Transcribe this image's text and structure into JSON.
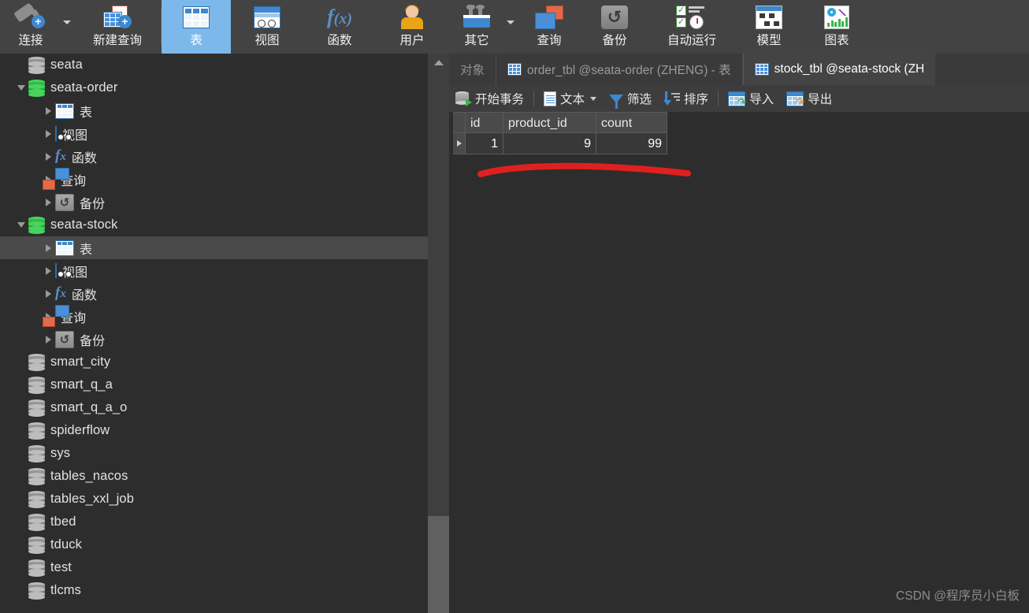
{
  "ribbon": {
    "items": [
      {
        "label": "连接",
        "icon": "plug-plus-icon",
        "has_caret": true,
        "active": false
      },
      {
        "label": "新建查询",
        "icon": "new-query-icon",
        "has_caret": false,
        "active": false
      },
      {
        "label": "表",
        "icon": "table-icon",
        "has_caret": false,
        "active": true
      },
      {
        "label": "视图",
        "icon": "view-icon",
        "has_caret": false,
        "active": false
      },
      {
        "label": "函数",
        "icon": "function-fx-icon",
        "has_caret": false,
        "active": false
      },
      {
        "label": "用户",
        "icon": "user-icon",
        "has_caret": false,
        "active": false
      },
      {
        "label": "其它",
        "icon": "toolbox-icon",
        "has_caret": true,
        "active": false
      },
      {
        "label": "查询",
        "icon": "query-icon",
        "has_caret": false,
        "active": false
      },
      {
        "label": "备份",
        "icon": "backup-icon",
        "has_caret": false,
        "active": false
      },
      {
        "label": "自动运行",
        "icon": "automation-icon",
        "has_caret": false,
        "active": false
      },
      {
        "label": "模型",
        "icon": "model-icon",
        "has_caret": false,
        "active": false
      },
      {
        "label": "图表",
        "icon": "chart-icon",
        "has_caret": false,
        "active": false
      }
    ],
    "active_bg": "#7cb8ea"
  },
  "sidebar": {
    "tree": [
      {
        "label": "seata",
        "type": "database",
        "icon": "database-gray-icon",
        "indent": 0,
        "twisty": "none",
        "selected": false
      },
      {
        "label": "seata-order",
        "type": "database",
        "icon": "database-green-icon",
        "indent": 0,
        "twisty": "expanded",
        "selected": false
      },
      {
        "label": "表",
        "type": "folder",
        "icon": "table-icon",
        "indent": 1,
        "twisty": "collapsed",
        "selected": false
      },
      {
        "label": "视图",
        "type": "folder",
        "icon": "view-icon",
        "indent": 1,
        "twisty": "collapsed",
        "selected": false
      },
      {
        "label": "函数",
        "type": "folder",
        "icon": "function-fx-icon",
        "indent": 1,
        "twisty": "collapsed",
        "selected": false
      },
      {
        "label": "查询",
        "type": "folder",
        "icon": "query-icon",
        "indent": 1,
        "twisty": "collapsed",
        "selected": false
      },
      {
        "label": "备份",
        "type": "folder",
        "icon": "backup-icon",
        "indent": 1,
        "twisty": "collapsed",
        "selected": false
      },
      {
        "label": "seata-stock",
        "type": "database",
        "icon": "database-green-icon",
        "indent": 0,
        "twisty": "expanded",
        "selected": false
      },
      {
        "label": "表",
        "type": "folder",
        "icon": "table-icon",
        "indent": 1,
        "twisty": "collapsed",
        "selected": true
      },
      {
        "label": "视图",
        "type": "folder",
        "icon": "view-icon",
        "indent": 1,
        "twisty": "collapsed",
        "selected": false
      },
      {
        "label": "函数",
        "type": "folder",
        "icon": "function-fx-icon",
        "indent": 1,
        "twisty": "collapsed",
        "selected": false
      },
      {
        "label": "查询",
        "type": "folder",
        "icon": "query-icon",
        "indent": 1,
        "twisty": "collapsed",
        "selected": false
      },
      {
        "label": "备份",
        "type": "folder",
        "icon": "backup-icon",
        "indent": 1,
        "twisty": "collapsed",
        "selected": false
      },
      {
        "label": "smart_city",
        "type": "database",
        "icon": "database-gray-icon",
        "indent": 0,
        "twisty": "none",
        "selected": false
      },
      {
        "label": "smart_q_a",
        "type": "database",
        "icon": "database-gray-icon",
        "indent": 0,
        "twisty": "none",
        "selected": false
      },
      {
        "label": "smart_q_a_o",
        "type": "database",
        "icon": "database-gray-icon",
        "indent": 0,
        "twisty": "none",
        "selected": false
      },
      {
        "label": "spiderflow",
        "type": "database",
        "icon": "database-gray-icon",
        "indent": 0,
        "twisty": "none",
        "selected": false
      },
      {
        "label": "sys",
        "type": "database",
        "icon": "database-gray-icon",
        "indent": 0,
        "twisty": "none",
        "selected": false
      },
      {
        "label": "tables_nacos",
        "type": "database",
        "icon": "database-gray-icon",
        "indent": 0,
        "twisty": "none",
        "selected": false
      },
      {
        "label": "tables_xxl_job",
        "type": "database",
        "icon": "database-gray-icon",
        "indent": 0,
        "twisty": "none",
        "selected": false
      },
      {
        "label": "tbed",
        "type": "database",
        "icon": "database-gray-icon",
        "indent": 0,
        "twisty": "none",
        "selected": false
      },
      {
        "label": "tduck",
        "type": "database",
        "icon": "database-gray-icon",
        "indent": 0,
        "twisty": "none",
        "selected": false
      },
      {
        "label": "test",
        "type": "database",
        "icon": "database-gray-icon",
        "indent": 0,
        "twisty": "none",
        "selected": false
      },
      {
        "label": "tlcms",
        "type": "database",
        "icon": "database-gray-icon",
        "indent": 0,
        "twisty": "none",
        "selected": false
      }
    ],
    "scrollbar": {
      "up_arrow_icon": "chevron-up-icon"
    }
  },
  "tabs": [
    {
      "label": "对象",
      "icon": null,
      "state": "object"
    },
    {
      "label": "order_tbl @seata-order (ZHENG) - 表",
      "icon": "table-icon",
      "state": "inactive"
    },
    {
      "label": "stock_tbl @seata-stock (ZH",
      "icon": "table-icon",
      "state": "active"
    }
  ],
  "subtoolbar": [
    {
      "label": "开始事务",
      "icon": "begin-transaction-icon",
      "caret": false
    },
    {
      "label": "文本",
      "icon": "text-icon",
      "caret": true
    },
    {
      "label": "筛选",
      "icon": "filter-icon",
      "caret": false
    },
    {
      "label": "排序",
      "icon": "sort-icon",
      "caret": false
    },
    {
      "label": "导入",
      "icon": "import-icon",
      "caret": false
    },
    {
      "label": "导出",
      "icon": "export-icon",
      "caret": false
    }
  ],
  "grid": {
    "columns": [
      "id",
      "product_id",
      "count"
    ],
    "rows": [
      {
        "marker": "current-row-marker",
        "values": [
          "1",
          "9",
          "99"
        ]
      }
    ]
  },
  "annotation": {
    "color": "#e02020",
    "shape": "hand-drawn-underline"
  },
  "watermark": {
    "text": "CSDN @程序员小白板"
  }
}
